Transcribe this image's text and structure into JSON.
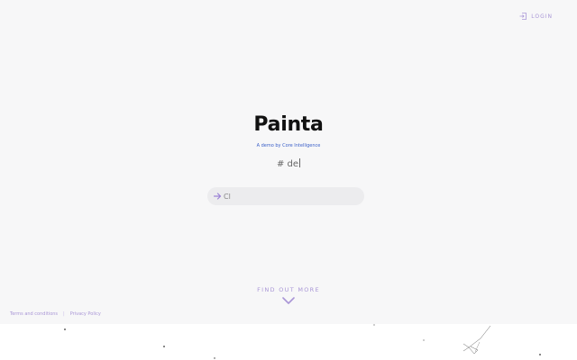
{
  "header": {
    "login_label": "LOGIN"
  },
  "hero": {
    "title": "Painta",
    "subtitle": "A demo by Core Intelligence",
    "hash_text": "# de"
  },
  "search": {
    "value": "Cl",
    "placeholder": ""
  },
  "find_more": {
    "label": "FIND OUT MORE"
  },
  "footer": {
    "terms_label": "Terms and conditions",
    "separator": "|",
    "privacy_label": "Privacy Policy"
  },
  "colors": {
    "accent": "#a996d6",
    "subtitle": "#3a5fc8",
    "hero_background": "#f7f7f8"
  },
  "icons": {
    "login": "login-arrow-icon",
    "search_arrow": "arrow-right-icon",
    "chevron": "chevron-down-icon"
  }
}
